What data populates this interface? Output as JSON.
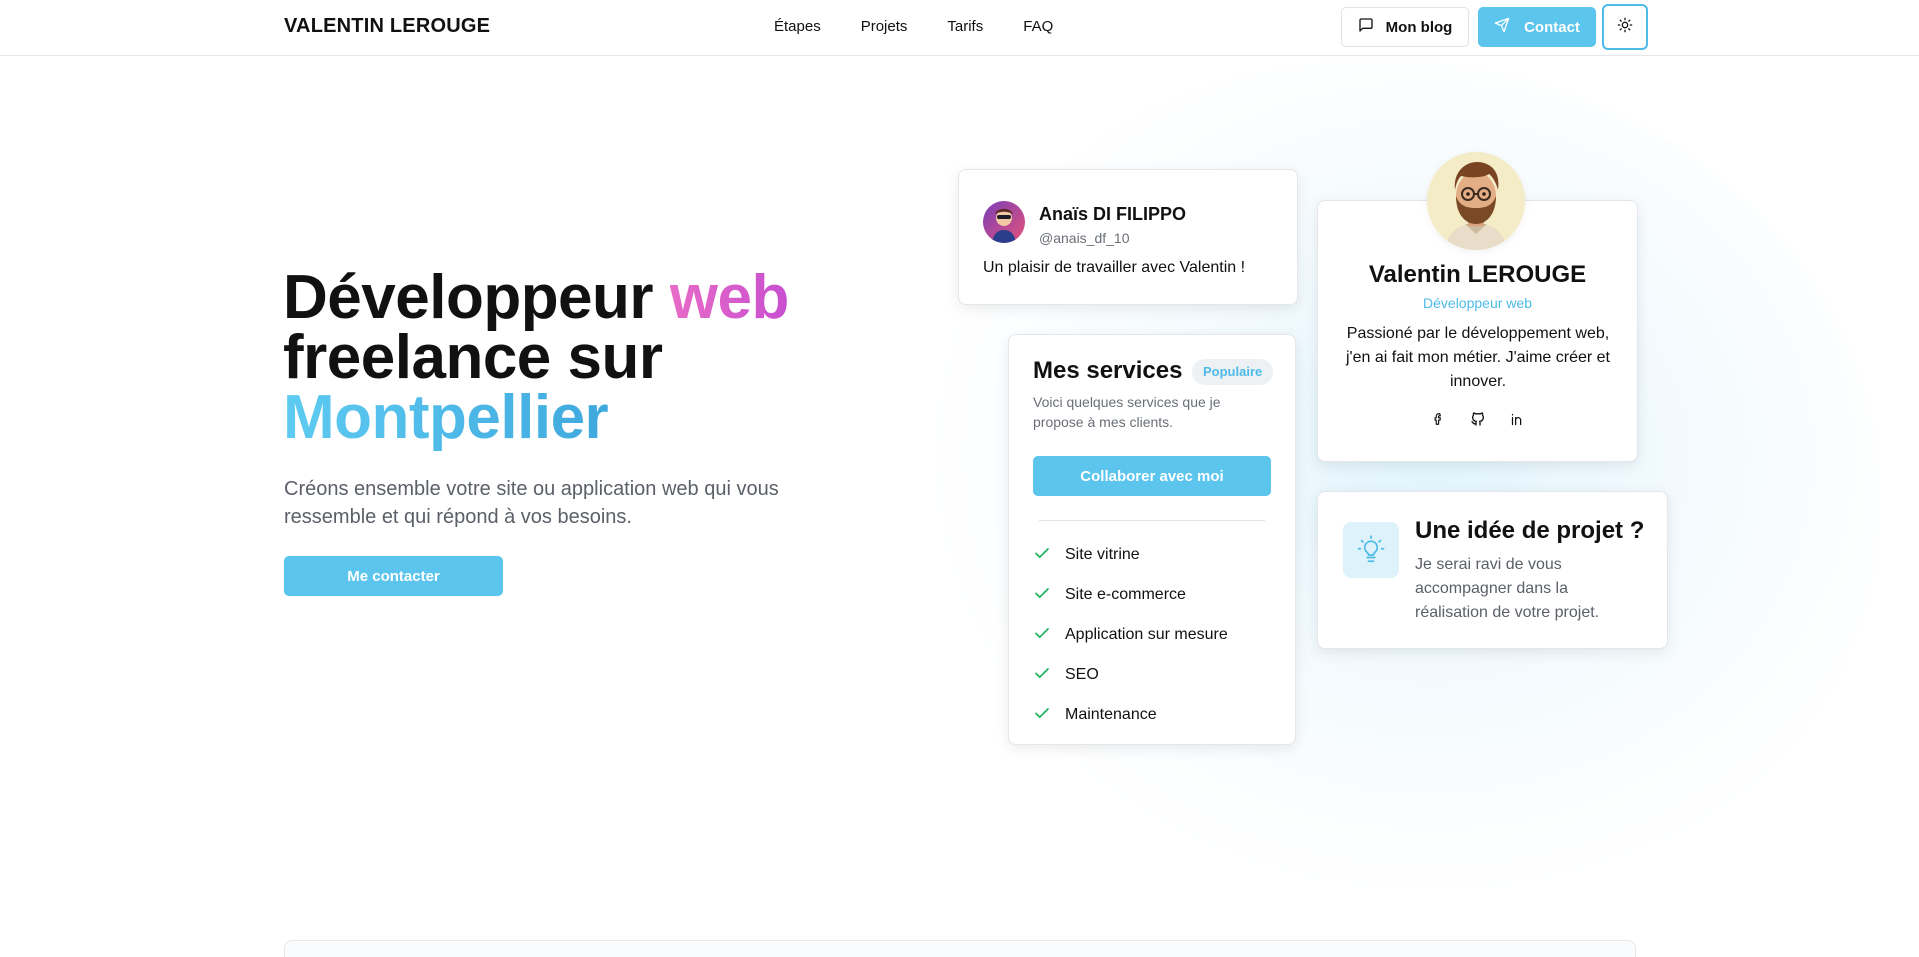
{
  "header": {
    "brand": "VALENTIN LEROUGE",
    "nav": [
      "Étapes",
      "Projets",
      "Tarifs",
      "FAQ"
    ],
    "blog_label": "Mon blog",
    "contact_label": "Contact"
  },
  "hero": {
    "title_part1": "Développeur ",
    "title_highlight1": "web",
    "title_part2": "freelance sur",
    "title_highlight2": "Montpellier",
    "subtitle": "Créons ensemble votre site ou application web qui vous ressemble et qui répond à vos besoins.",
    "cta_label": "Me contacter"
  },
  "testimonial": {
    "name": "Anaïs DI FILIPPO",
    "handle": "@anais_df_10",
    "quote": "Un plaisir de travailler avec Valentin !"
  },
  "services": {
    "title": "Mes services",
    "badge": "Populaire",
    "description": "Voici quelques services que je propose à mes clients.",
    "cta_label": "Collaborer avec moi",
    "items": [
      "Site vitrine",
      "Site e-commerce",
      "Application sur mesure",
      "SEO",
      "Maintenance"
    ]
  },
  "profile": {
    "name": "Valentin LEROUGE",
    "role": "Développeur web",
    "bio": "Passioné par le développement web, j'en ai fait mon métier. J'aime créer et innover."
  },
  "idea": {
    "title": "Une idée de projet ?",
    "description": "Je serai ravi de vous accompagner dans la réalisation de votre projet."
  },
  "colors": {
    "accent_blue": "#5bc5ee",
    "accent_pink": "#d95ccb",
    "check_green": "#22b35a",
    "text_muted": "#5b6068"
  },
  "icons": {
    "blog": "message-square-icon",
    "contact": "send-icon",
    "theme": "sun-icon",
    "check": "check-icon",
    "socials": [
      "facebook-icon",
      "github-icon",
      "linkedin-icon"
    ],
    "idea": "lightbulb-icon"
  }
}
